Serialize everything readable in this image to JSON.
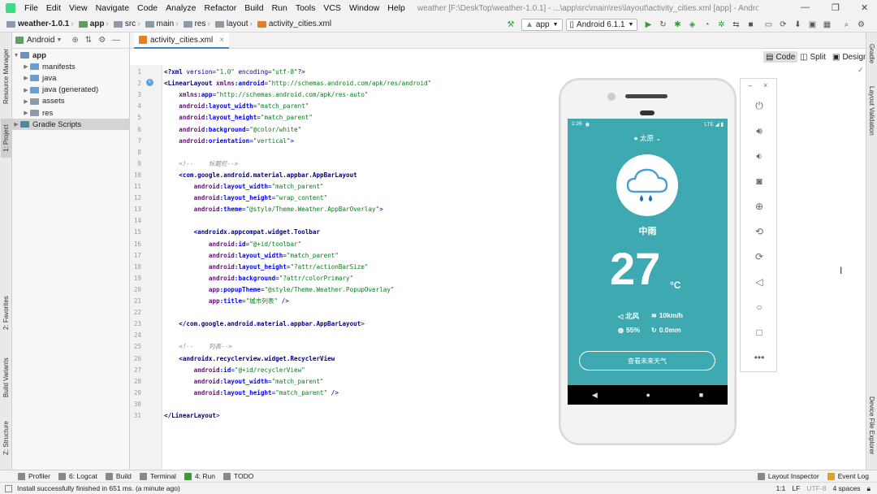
{
  "window": {
    "title": "weather [F:\\DeskTop\\weather-1.0.1] - ...\\app\\src\\main\\res\\layout\\activity_cities.xml [app] - Android Studio"
  },
  "menu": [
    "File",
    "Edit",
    "View",
    "Navigate",
    "Code",
    "Analyze",
    "Refactor",
    "Build",
    "Run",
    "Tools",
    "VCS",
    "Window",
    "Help"
  ],
  "breadcrumbs": [
    "weather-1.0.1",
    "app",
    "src",
    "main",
    "res",
    "layout",
    "activity_cities.xml"
  ],
  "toolbar": {
    "run_config": "app",
    "device": "Android 6.1.1"
  },
  "left_tabs": [
    "Resource Manager",
    "1: Project",
    "2: Favorites",
    "Build Variants",
    "Z: Structure"
  ],
  "project_panel": {
    "view_mode": "Android",
    "tree": [
      {
        "label": "app",
        "level": 0
      },
      {
        "label": "manifests",
        "level": 1
      },
      {
        "label": "java",
        "level": 1
      },
      {
        "label": "java (generated)",
        "level": 1
      },
      {
        "label": "assets",
        "level": 1
      },
      {
        "label": "res",
        "level": 1
      },
      {
        "label": "Gradle Scripts",
        "level": 0
      }
    ]
  },
  "editor_tab": "activity_cities.xml",
  "view_modes": [
    "Code",
    "Split",
    "Design"
  ],
  "code_lines": [
    "<?xml version=\"1.0\" encoding=\"utf-8\"?>",
    "<LinearLayout xmlns:android=\"http://schemas.android.com/apk/res/android\"",
    "    xmlns:app=\"http://schemas.android.com/apk/res-auto\"",
    "    android:layout_width=\"match_parent\"",
    "    android:layout_height=\"match_parent\"",
    "    android:background=\"@color/white\"",
    "    android:orientation=\"vertical\">",
    "",
    "    <!--    标题栏-->",
    "    <com.google.android.material.appbar.AppBarLayout",
    "        android:layout_width=\"match_parent\"",
    "        android:layout_height=\"wrap_content\"",
    "        android:theme=\"@style/Theme.Weather.AppBarOverlay\">",
    "",
    "        <androidx.appcompat.widget.Toolbar",
    "            android:id=\"@+id/toolbar\"",
    "            android:layout_width=\"match_parent\"",
    "            android:layout_height=\"?attr/actionBarSize\"",
    "            android:background=\"?attr/colorPrimary\"",
    "            app:popupTheme=\"@style/Theme.Weather.PopupOverlay\"",
    "            app:title=\"城市列表\" />",
    "",
    "    </com.google.android.material.appbar.AppBarLayout>",
    "",
    "    <!--    列表-->",
    "    <androidx.recyclerview.widget.RecyclerView",
    "        android:id=\"@+id/recyclerView\"",
    "        android:layout_width=\"match_parent\"",
    "        android:layout_height=\"match_parent\" />",
    "",
    "</LinearLayout>"
  ],
  "phone": {
    "status_time": "1:26",
    "status_right": "LTE ◢ ▮",
    "city": "太原",
    "weather": "中雨",
    "temperature": "27",
    "unit": "°C",
    "wind_dir": "北风",
    "wind_speed": "10km/h",
    "humidity": "55%",
    "precip": "0.0mm",
    "forecast_button": "查看未来天气",
    "screen_color": "#3ea9b1"
  },
  "right_tabs": [
    "Gradle",
    "Layout Validation",
    "Device File Explorer"
  ],
  "bottom_tools": [
    {
      "label": "Profiler"
    },
    {
      "label": "6: Logcat"
    },
    {
      "label": "Build"
    },
    {
      "label": "Terminal"
    },
    {
      "label": "4: Run"
    },
    {
      "label": "TODO"
    }
  ],
  "bottom_right_tools": [
    "Layout Inspector",
    "Event Log"
  ],
  "statusbar": {
    "message": "Install successfully finished in 651 ms. (a minute ago)",
    "position": "1:1",
    "line_sep": "LF",
    "encoding": "UTF-8",
    "indent": "4 spaces"
  }
}
